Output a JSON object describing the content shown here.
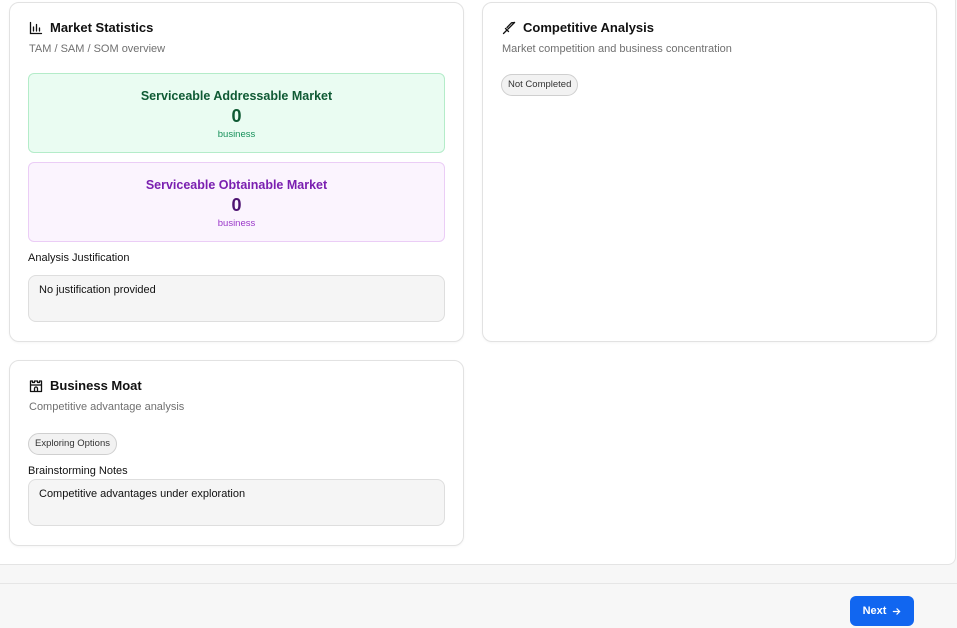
{
  "market_statistics": {
    "title": "Market Statistics",
    "subtitle": "TAM / SAM / SOM overview",
    "icon": "bar-chart-icon",
    "sam": {
      "label": "Serviceable Addressable Market",
      "value": "0",
      "unit": "business"
    },
    "som": {
      "label": "Serviceable Obtainable Market",
      "value": "0",
      "unit": "business"
    },
    "justification_label": "Analysis Justification",
    "justification_text": "No justification provided"
  },
  "competitive_analysis": {
    "title": "Competitive Analysis",
    "subtitle": "Market competition and business concentration",
    "icon": "sword-icon",
    "status": "Not Completed"
  },
  "business_moat": {
    "title": "Business Moat",
    "subtitle": "Competitive advantage analysis",
    "icon": "castle-icon",
    "status": "Exploring Options",
    "notes_label": "Brainstorming Notes",
    "notes_text": "Competitive advantages under exploration"
  },
  "footer": {
    "next_label": "Next",
    "next_icon": "arrow-right-icon"
  },
  "colors": {
    "accent": "#1166f0",
    "sam_bg": "#eafcf2",
    "sam_text": "#0f5a34",
    "som_bg": "#fbf4fe",
    "som_text": "#7a1fb0"
  }
}
